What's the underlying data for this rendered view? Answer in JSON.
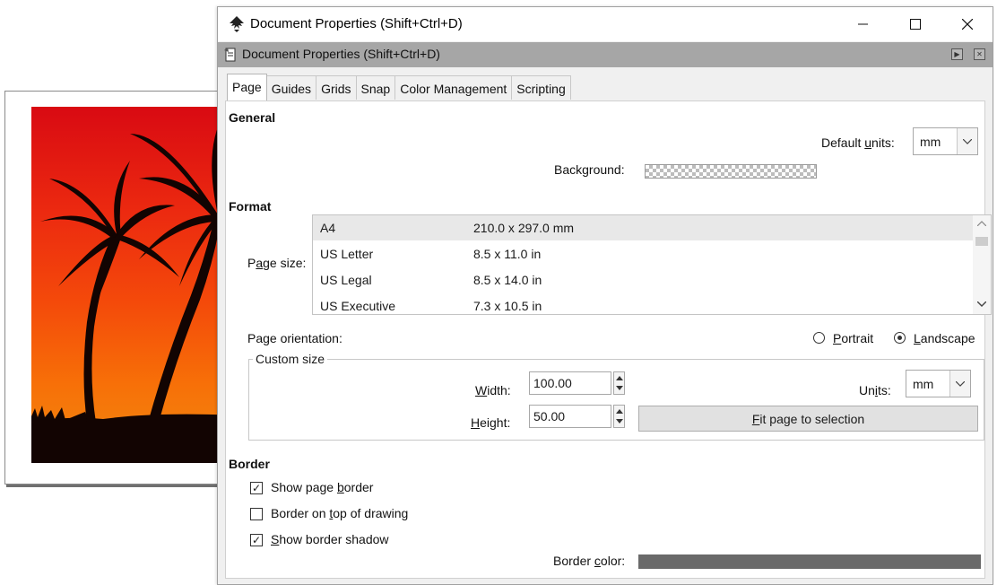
{
  "window": {
    "title": "Document Properties (Shift+Ctrl+D)",
    "controls": {
      "minimize": "minimize",
      "maximize": "maximize",
      "close": "close"
    }
  },
  "panel": {
    "title": "Document Properties (Shift+Ctrl+D)"
  },
  "tabs": [
    {
      "label": "Page",
      "active": true
    },
    {
      "label": "Guides",
      "active": false
    },
    {
      "label": "Grids",
      "active": false
    },
    {
      "label": "Snap",
      "active": false
    },
    {
      "label": "Color Management",
      "active": false
    },
    {
      "label": "Scripting",
      "active": false
    }
  ],
  "general": {
    "heading": "General",
    "default_units_label_pre": "Default ",
    "default_units_label_u": "u",
    "default_units_label_post": "nits:",
    "default_units_value": "mm",
    "background_label": "Background:"
  },
  "format": {
    "heading": "Format",
    "page_size_label_pre": "P",
    "page_size_label_u": "a",
    "page_size_label_post": "ge size:",
    "page_sizes": [
      {
        "name": "A4",
        "dims": "210.0 x 297.0 mm",
        "selected": true
      },
      {
        "name": "US Letter",
        "dims": "8.5 x 11.0 in",
        "selected": false
      },
      {
        "name": "US Legal",
        "dims": "8.5 x 14.0 in",
        "selected": false
      },
      {
        "name": "US Executive",
        "dims": "7.3 x 10.5 in",
        "selected": false
      }
    ],
    "orientation_label": "Page orientation:",
    "portrait_pre": "",
    "portrait_u": "P",
    "portrait_post": "ortrait",
    "landscape_pre": "",
    "landscape_u": "L",
    "landscape_post": "andscape",
    "orientation_selected": "Landscape"
  },
  "custom_size": {
    "legend": "Custom size",
    "width_pre": "",
    "width_u": "W",
    "width_post": "idth:",
    "width_value": "100.00",
    "height_pre": "",
    "height_u": "H",
    "height_post": "eight:",
    "height_value": "50.00",
    "units_pre": "Un",
    "units_u": "i",
    "units_post": "ts:",
    "units_value": "mm",
    "fit_pre": "",
    "fit_u": "F",
    "fit_post": "it page to selection"
  },
  "border": {
    "heading": "Border",
    "show_page_border_pre": "Show page ",
    "show_page_border_u": "b",
    "show_page_border_post": "order",
    "show_page_border_checked": true,
    "border_on_top_pre": "Border on ",
    "border_on_top_u": "t",
    "border_on_top_post": "op of drawing",
    "border_on_top_checked": false,
    "show_shadow_pre": "",
    "show_shadow_u": "S",
    "show_shadow_post": "how border shadow",
    "show_shadow_checked": true,
    "border_color_label_pre": "Border ",
    "border_color_label_u": "c",
    "border_color_label_post": "olor:",
    "border_color": "#6a6a6a"
  },
  "colors": {
    "panel_bar": "#a6a6a6",
    "dialog_bg": "#f0f0f0",
    "sky_top": "#d90a12",
    "sky_bottom": "#f08a10"
  },
  "icons": {
    "app": "inkscape-icon",
    "panel": "document-properties-icon",
    "checkmark": "✓"
  }
}
